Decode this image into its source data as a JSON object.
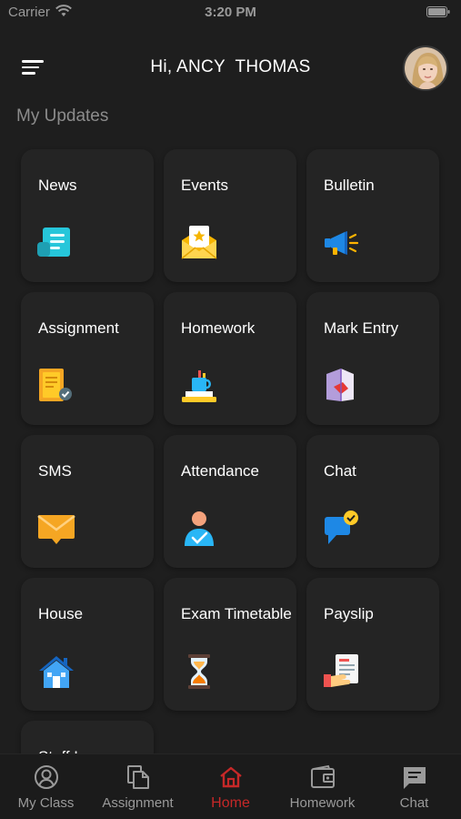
{
  "status_bar": {
    "carrier": "Carrier",
    "time": "3:20 PM"
  },
  "header": {
    "greeting": "Hi, ANCY  THOMAS"
  },
  "section": {
    "title": "My Updates"
  },
  "tiles": [
    {
      "label": "News",
      "icon": "news-icon"
    },
    {
      "label": "Events",
      "icon": "events-icon"
    },
    {
      "label": "Bulletin",
      "icon": "bulletin-icon"
    },
    {
      "label": "Assignment",
      "icon": "assignment-icon"
    },
    {
      "label": "Homework",
      "icon": "homework-icon"
    },
    {
      "label": "Mark Entry",
      "icon": "mark-entry-icon"
    },
    {
      "label": "SMS",
      "icon": "sms-icon"
    },
    {
      "label": "Attendance",
      "icon": "attendance-icon"
    },
    {
      "label": "Chat",
      "icon": "chat-icon"
    },
    {
      "label": "House",
      "icon": "house-icon"
    },
    {
      "label": "Exam Timetable",
      "icon": "exam-timetable-icon"
    },
    {
      "label": "Payslip",
      "icon": "payslip-icon"
    },
    {
      "label": "Staff Leave",
      "icon": "staff-leave-icon"
    }
  ],
  "bottom_nav": [
    {
      "label": "My Class",
      "icon": "my-class-icon"
    },
    {
      "label": "Assignment",
      "icon": "assignment-tab-icon"
    },
    {
      "label": "Home",
      "icon": "home-icon",
      "active": true
    },
    {
      "label": "Homework",
      "icon": "homework-tab-icon"
    },
    {
      "label": "Chat",
      "icon": "chat-tab-icon"
    }
  ],
  "colors": {
    "background": "#1e1e1e",
    "card": "#242424",
    "active_tab": "#c62828",
    "inactive_tab": "#9a9a9a"
  }
}
